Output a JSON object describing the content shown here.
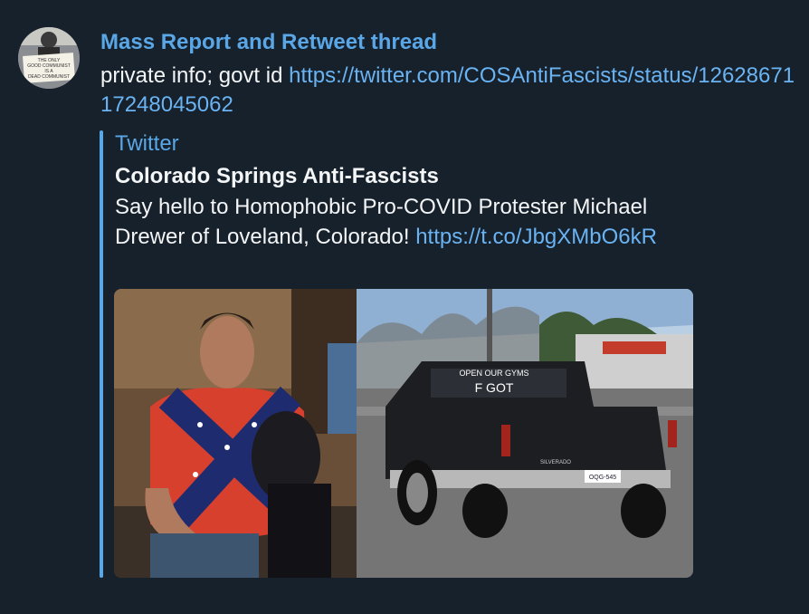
{
  "message": {
    "sender": "Mass Report and Retweet thread",
    "text_prefix": "private info; govt id ",
    "link": "https://twitter.com/COSAntiFascists/status/1262867117248045062"
  },
  "preview": {
    "site_name": "Twitter",
    "title": "Colorado Springs Anti-Fascists",
    "description_text": "Say hello to Homophobic Pro-COVID Protester Michael Drewer of Loveland, Colorado! ",
    "description_link": "https://t.co/JbgXMbO6kR"
  },
  "avatar_sign": {
    "line1": "THE ONLY",
    "line2": "GOOD COMMUNIST",
    "line3": "IS A",
    "line4": "DEAD COMMUNIST"
  },
  "image_texts": {
    "truck_line1": "OPEN OUR GYMS",
    "truck_line2": "F GOT",
    "badge": "SILVERADO",
    "plate": "OQG-545"
  },
  "colors": {
    "background": "#17212b",
    "accent": "#5aa7e8",
    "link": "#6ab3f3",
    "text": "#f3f5f7"
  }
}
